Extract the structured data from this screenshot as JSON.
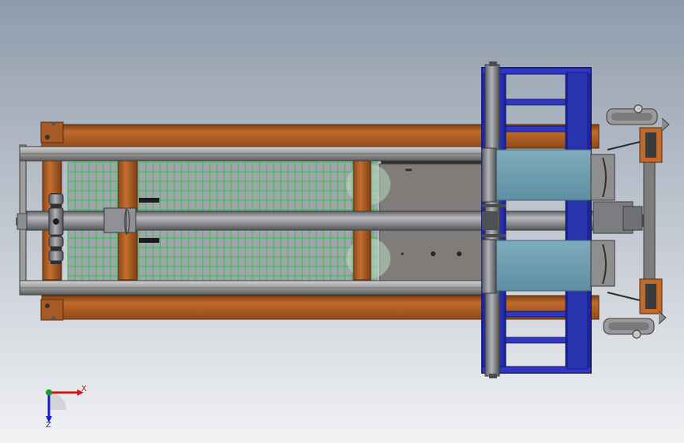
{
  "viewport": {
    "background_top": "#8f9bac",
    "background_bottom": "#f1f2f4"
  },
  "colors": {
    "wood": "#b8642b",
    "wood_dark": "#7b3f14",
    "steel": "#8c8c8c",
    "steel_dark": "#575757",
    "blue": "#2b33b8",
    "blue_light": "#3f56e2",
    "mesh": "#2ec24a",
    "teal": "#6b9bad",
    "plate": "#7f7c79",
    "shaft": "#888a8e"
  },
  "model": {
    "name_icon": "ground-frame-assembly-icon"
  },
  "triad": {
    "x_label": "X",
    "z_label": "Z",
    "x_color": "#cc1a1a",
    "z_color": "#1a1acc",
    "origin_color": "#1f9a24"
  }
}
